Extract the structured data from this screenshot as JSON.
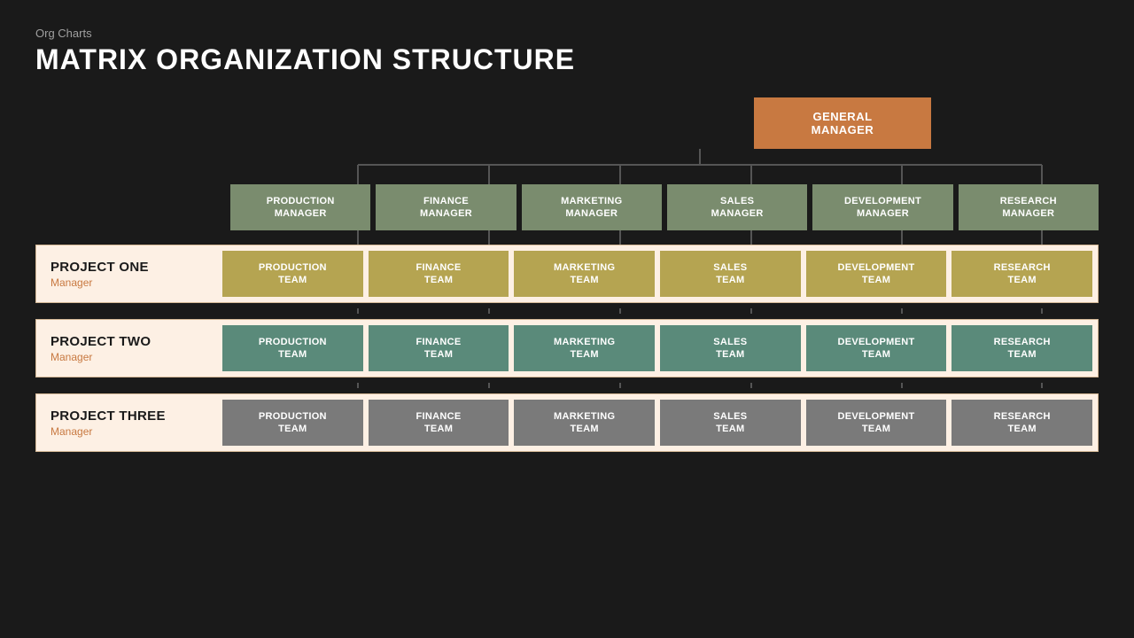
{
  "header": {
    "category": "Org Charts",
    "title": "MATRIX ORGANIZATION STRUCTURE"
  },
  "chart": {
    "gm": "GENERAL MANAGER",
    "managers": [
      "PRODUCTION\nMANAGER",
      "FINANCE\nMANAGER",
      "MARKETING\nMANAGER",
      "SALES\nMANAGER",
      "DEVELOPMENT\nMANAGER",
      "RESEARCH\nMANAGER"
    ],
    "projects": [
      {
        "name": "PROJECT ONE",
        "role": "Manager",
        "teams": [
          "PRODUCTION\nTEAM",
          "FINANCE\nTEAM",
          "MARKETING\nTEAM",
          "SALES\nTEAM",
          "DEVELOPMENT\nTEAM",
          "RESEARCH\nTEAM"
        ],
        "style": "r1"
      },
      {
        "name": "PROJECT TWO",
        "role": "Manager",
        "teams": [
          "PRODUCTION\nTEAM",
          "FINANCE\nTEAM",
          "MARKETING\nTEAM",
          "SALES\nTEAM",
          "DEVELOPMENT\nTEAM",
          "RESEARCH\nTEAM"
        ],
        "style": "r2"
      },
      {
        "name": "PROJECT THREE",
        "role": "Manager",
        "teams": [
          "PRODUCTION\nTEAM",
          "FINANCE\nTEAM",
          "MARKETING\nTEAM",
          "SALES\nTEAM",
          "DEVELOPMENT\nTEAM",
          "RESEARCH\nTEAM"
        ],
        "style": "r3"
      }
    ]
  },
  "colors": {
    "gm": "#c87941",
    "manager": "#7a8c6e",
    "team_r1": "#b5a451",
    "team_r2": "#5a8a7a",
    "team_r3": "#7a7a7a",
    "project_border": "#d4b896",
    "project_bg": "#fdf0e4",
    "line": "#555555",
    "bg": "#1a1a1a"
  }
}
